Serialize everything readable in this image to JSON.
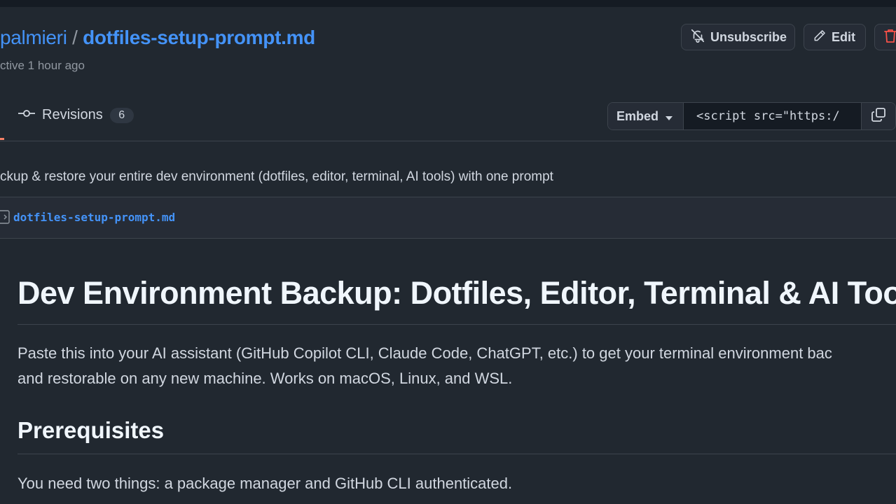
{
  "header": {
    "owner": "palmieri",
    "separator": "/",
    "gist_name": "dotfiles-setup-prompt.md",
    "activity": "ctive 1 hour ago"
  },
  "actions": {
    "unsubscribe_label": "Unsubscribe",
    "edit_label": "Edit"
  },
  "tabs": {
    "revisions_label": "Revisions",
    "revisions_count": "6"
  },
  "embed": {
    "label": "Embed",
    "value": "<script src=\"https:/"
  },
  "description": "ckup & restore your entire dev environment (dotfiles, editor, terminal, AI tools) with one prompt",
  "file": {
    "name": "dotfiles-setup-prompt.md"
  },
  "content": {
    "h1": "Dev Environment Backup: Dotfiles, Editor, Terminal & AI Tool",
    "intro_line1": "Paste this into your AI assistant (GitHub Copilot CLI, Claude Code, ChatGPT, etc.) to get your terminal environment bac",
    "intro_line2": "and restorable on any new machine. Works on macOS, Linux, and WSL.",
    "h2": "Prerequisites",
    "prereq_text": "You need two things: a package manager and GitHub CLI authenticated."
  },
  "colors": {
    "background": "#212830",
    "link": "#4493f8",
    "danger": "#f85149",
    "tab_underline": "#f78166"
  }
}
